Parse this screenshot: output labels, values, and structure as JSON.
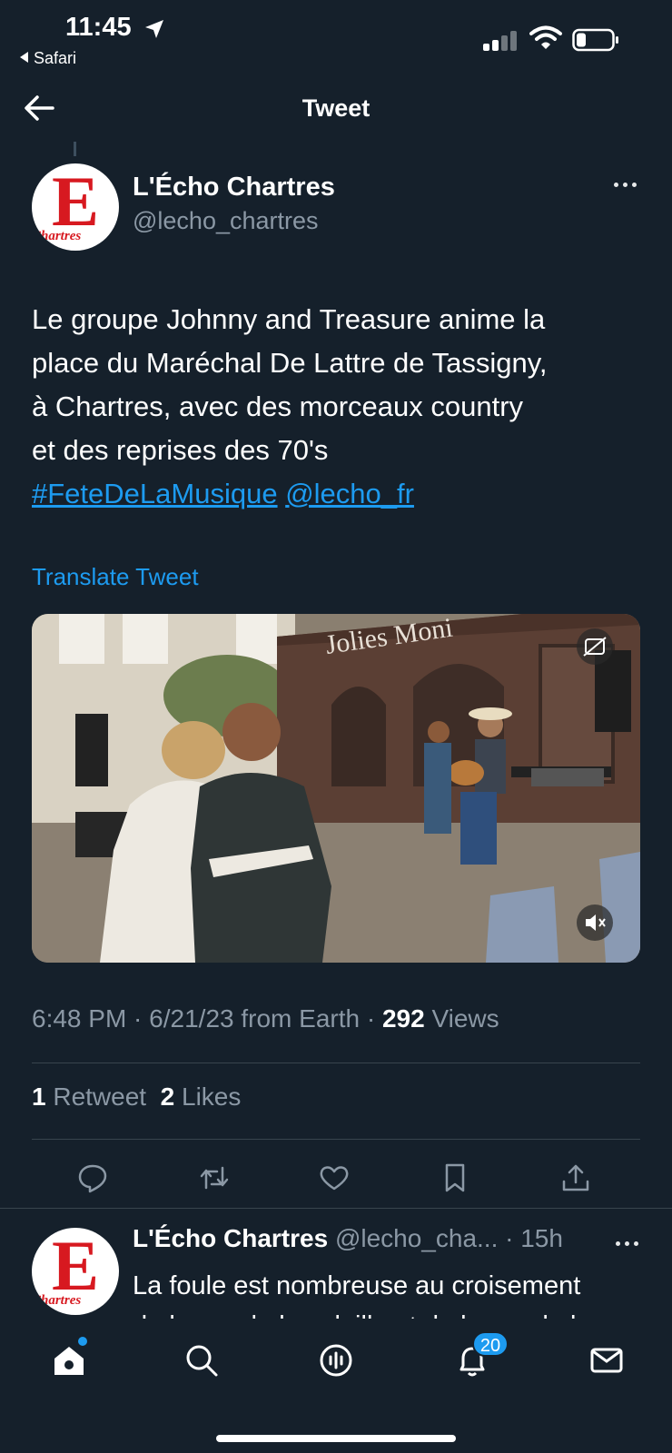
{
  "status_bar": {
    "time": "11:45",
    "back_app": "Safari"
  },
  "header": {
    "title": "Tweet"
  },
  "tweet": {
    "author_name": "L'Écho Chartres",
    "author_handle": "@lecho_chartres",
    "avatar_letter": "E",
    "avatar_word": "Chartres",
    "text_lines": [
      "Le groupe Johnny and Treasure anime la",
      "place du Maréchal De Lattre de Tassigny,",
      "à Chartres, avec des morceaux country",
      "et des reprises des 70's"
    ],
    "hashtag": "#FeteDeLaMusique",
    "mention": "@lecho_fr",
    "translate_label": "Translate Tweet",
    "media_sign": "Jolies Moni",
    "time": "6:48 PM",
    "date": "6/21/23",
    "source": "from Earth",
    "views_count": "292",
    "views_label": "Views",
    "retweets_count": "1",
    "retweets_label": "Retweet",
    "likes_count": "2",
    "likes_label": "Likes"
  },
  "reply": {
    "author_name": "L'Écho Chartres",
    "handle_time": "@lecho_cha... · 15h",
    "line1": "La foule est nombreuse au croisement",
    "line2": "de la rue de la volaille et de la rue de la"
  },
  "tabbar": {
    "notifications_badge": "20"
  },
  "colors": {
    "background": "#15202b",
    "accent": "#1d9bf0",
    "secondary_text": "#8b98a5",
    "brand_red": "#d71920"
  }
}
